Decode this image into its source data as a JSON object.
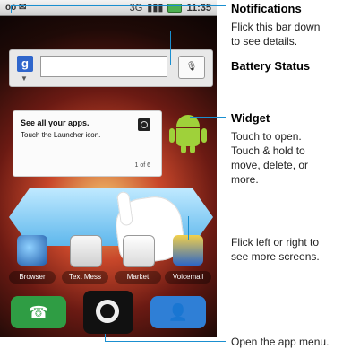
{
  "status_bar": {
    "left_icons": "mail",
    "network": "3G",
    "time": "11:35"
  },
  "widgets": {
    "tip_title": "See all your apps.",
    "tip_body": "Touch the Launcher icon.",
    "tip_page": "1 of 6"
  },
  "apps": [
    "Browser",
    "Text Mess",
    "Market",
    "Voicemail"
  ],
  "callouts": {
    "notifications": {
      "title": "Notifications",
      "body": "Flick this bar down\nto see details."
    },
    "battery": {
      "title": "Battery Status"
    },
    "widget": {
      "title": "Widget",
      "body": "Touch to open.\nTouch & hold to\nmove, delete, or\nmore."
    },
    "screens": {
      "body": "Flick left or right to\nsee more screens."
    },
    "app_menu": {
      "body": "Open the app menu."
    }
  },
  "colors": {
    "callout_line": "#1a8fd0",
    "swipe_arrow": "#5eb7ec",
    "android_green": "#9fd13a"
  }
}
